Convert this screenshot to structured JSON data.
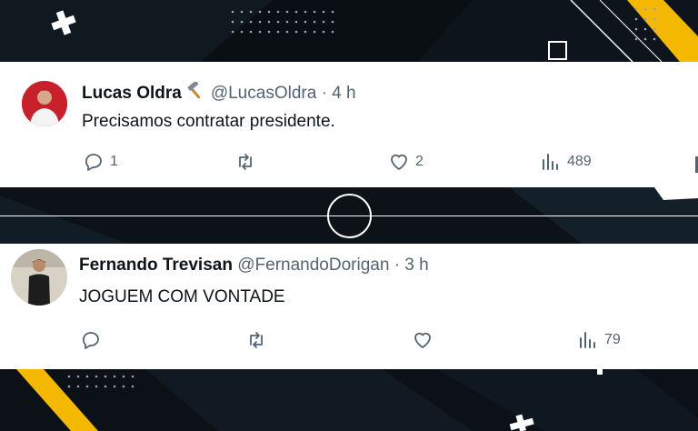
{
  "colors": {
    "background": "#0a0f14",
    "accent_yellow": "#f5b800",
    "card": "#ffffff",
    "text_primary": "#0f1419",
    "text_secondary": "#536471"
  },
  "tweets": [
    {
      "name": "Lucas Oldra",
      "badge_icon": "hammer-emoji-icon",
      "handle": "@LucasOldra",
      "separator": "·",
      "time": "4 h",
      "text": "Precisamos contratar presidente.",
      "replies": "1",
      "retweets": "",
      "likes": "2",
      "views": "489"
    },
    {
      "name": "Fernando Trevisan",
      "handle": "@FernandoDorigan",
      "separator": "·",
      "time": "3 h",
      "text": "JOGUEM COM VONTADE",
      "replies": "",
      "retweets": "",
      "likes": "",
      "views": "79"
    }
  ]
}
